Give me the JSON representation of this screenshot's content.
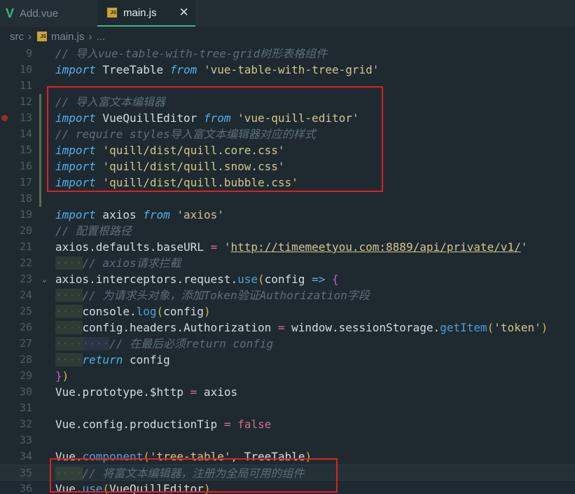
{
  "tabs": [
    {
      "label": "Add.vue",
      "icon": "vue-logo-icon",
      "active": false
    },
    {
      "label": "main.js",
      "icon": "js-file-icon",
      "active": true
    }
  ],
  "breadcrumb": {
    "folder": "src",
    "file": "main.js",
    "more": "..."
  },
  "lines": [
    {
      "n": "9",
      "html": "<span class='cmt'>// 导入vue-table-with-tree-grid树形表格组件</span>"
    },
    {
      "n": "10",
      "html": "<span class='kw'>import</span> TreeTable <span class='kw'>from</span> <span class='str'>'vue-table-with-tree-grid'</span>"
    },
    {
      "n": "11",
      "html": ""
    },
    {
      "n": "12",
      "html": "<span class='cmt'>// 导入富文本编辑器</span>"
    },
    {
      "n": "13",
      "html": "<span class='kw'>import</span> VueQuillEditor <span class='kw'>from</span> <span class='str'>'vue-quill-editor'</span>"
    },
    {
      "n": "14",
      "html": "<span class='cmt'>// require styles导入富文本编辑器对应的样式</span>"
    },
    {
      "n": "15",
      "html": "<span class='kw'>import</span> <span class='str'>'quill/dist/quill.core.css'</span>"
    },
    {
      "n": "16",
      "html": "<span class='kw'>import</span> <span class='str'>'quill/dist/quill.snow.css'</span>"
    },
    {
      "n": "17",
      "html": "<span class='kw'>import</span> <span class='str'>'quill/dist/quill.bubble.css'</span>"
    },
    {
      "n": "18",
      "html": ""
    },
    {
      "n": "19",
      "html": "<span class='kw'>import</span> axios <span class='kw'>from</span> <span class='str'>'axios'</span>"
    },
    {
      "n": "20",
      "html": "<span class='cmt'>// 配置根路径</span>"
    },
    {
      "n": "21",
      "html": "axios.defaults.baseURL <span class='op'>=</span> <span class='str'>'</span><span class='url'>http://timemeetyou.com:8889/api/private/v1/</span><span class='str'>'</span>"
    },
    {
      "n": "22",
      "html": "<span class='indent indent-a'>····</span><span class='cmt'>// axios请求拦截</span>"
    },
    {
      "n": "23",
      "html": "axios.interceptors.request.<span class='fn'>use</span><span class='paren'>(</span>config <span class='kw' style='font-style:normal'>=&gt;</span> <span class='brace'>{</span>"
    },
    {
      "n": "24",
      "html": "<span class='indent indent-a'>····</span><span class='cmt'>// 为请求头对象，添加Token验证Authorization字段</span>"
    },
    {
      "n": "25",
      "html": "<span class='indent indent-a'>····</span>console.<span class='fn'>log</span><span class='paren'>(</span>config<span class='paren'>)</span>"
    },
    {
      "n": "26",
      "html": "<span class='indent indent-a'>····</span>config.headers.Authorization <span class='op'>=</span> window.sessionStorage.<span class='fn'>getItem</span><span class='paren'>(</span><span class='str'>'token'</span><span class='paren'>)</span>"
    },
    {
      "n": "27",
      "html": "<span class='indent indent-a'>····</span><span class='indent indent-b'>····</span><span class='cmt'>// 在最后必须return config</span>"
    },
    {
      "n": "28",
      "html": "<span class='indent indent-a'>····</span><span class='kw'>return</span> config"
    },
    {
      "n": "29",
      "html": "<span class='brace'>}</span><span class='paren'>)</span>"
    },
    {
      "n": "30",
      "html": "Vue.prototype.$http <span class='op'>=</span> axios"
    },
    {
      "n": "31",
      "html": ""
    },
    {
      "n": "32",
      "html": "Vue.config.productionTip <span class='op'>=</span> <span class='bool'>false</span>"
    },
    {
      "n": "33",
      "html": ""
    },
    {
      "n": "34",
      "html": "Vue.<span class='fn'>component</span><span class='paren'>(</span><span class='str'>'tree-table'</span>, TreeTable<span class='paren'>)</span>"
    },
    {
      "n": "35",
      "html": "<span class='indent indent-a'>····</span><span class='cmt'>// 将富文本编辑器，注册为全局可用的组件</span>"
    },
    {
      "n": "36",
      "html": "Vue.<span class='fn'>use</span><span class='paren'>(</span>VueQuillEditor<span class='paren'>)</span>"
    }
  ]
}
